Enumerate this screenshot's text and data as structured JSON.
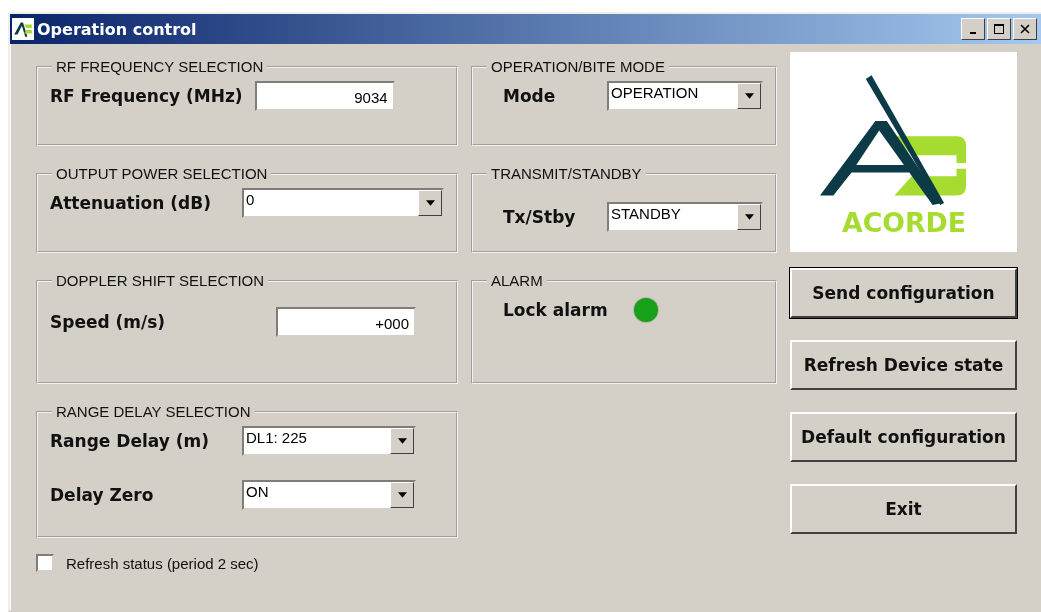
{
  "window": {
    "title": "Operation control"
  },
  "left_groups": [
    {
      "title": "RF FREQUENCY SELECTION",
      "rows": [
        {
          "kind": "text",
          "label": "RF Frequency (MHz)",
          "value": "9034"
        }
      ]
    },
    {
      "title": "OUTPUT POWER SELECTION",
      "rows": [
        {
          "kind": "dropdown",
          "label": "Attenuation (dB)",
          "value": "0"
        }
      ]
    },
    {
      "title": "DOPPLER SHIFT SELECTION",
      "rows": [
        {
          "kind": "text",
          "label": "Speed (m/s)",
          "value": "+000"
        }
      ]
    },
    {
      "title": "RANGE DELAY SELECTION",
      "rows": [
        {
          "kind": "dropdown",
          "label": "Range Delay (m)",
          "value": "DL1: 225"
        },
        {
          "kind": "dropdown",
          "label": "Delay Zero",
          "value": "ON"
        }
      ]
    }
  ],
  "middle_groups": [
    {
      "title": "OPERATION/BITE MODE",
      "rows": [
        {
          "kind": "dropdown",
          "label": "Mode",
          "value": "OPERATION"
        }
      ]
    },
    {
      "title": "TRANSMIT/STANDBY",
      "rows": [
        {
          "kind": "dropdown",
          "label": "Tx/Stby",
          "value": "STANDBY"
        }
      ]
    },
    {
      "title": "ALARM",
      "rows": [
        {
          "kind": "led",
          "label": "Lock alarm",
          "color": "#18a018"
        }
      ]
    }
  ],
  "logo": {
    "text": "ACORDE"
  },
  "buttons": [
    {
      "label": "Send configuration",
      "selected": true
    },
    {
      "label": "Refresh Device state",
      "selected": false
    },
    {
      "label": "Default configuration",
      "selected": false
    },
    {
      "label": "Exit",
      "selected": false
    }
  ],
  "refresh_checkbox": {
    "label": "Refresh status (period 2 sec)",
    "checked": false
  }
}
